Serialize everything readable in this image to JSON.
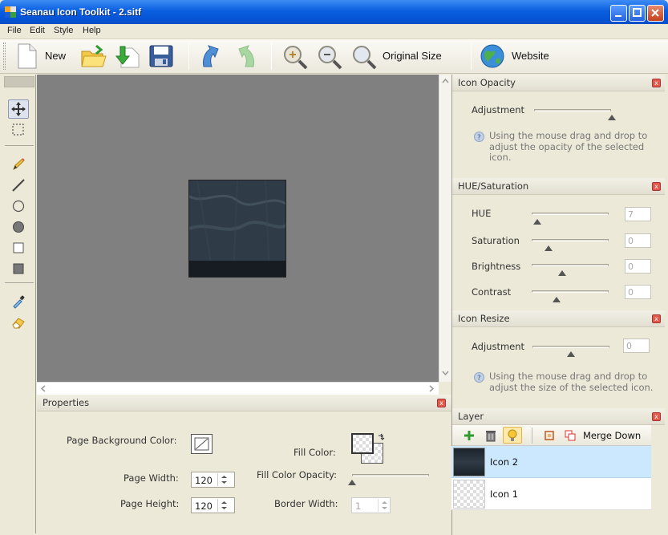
{
  "app": {
    "title": "Seanau Icon Toolkit - 2.sitf"
  },
  "menu": [
    "File",
    "Edit",
    "Style",
    "Help"
  ],
  "toolbar": {
    "new_label": "New",
    "original_size_label": "Original Size",
    "website_label": "Website"
  },
  "icon_opacity": {
    "title": "Icon Opacity",
    "adjustment_label": "Adjustment",
    "hint": "Using the mouse drag and drop to adjust the opacity of the selected icon."
  },
  "hue_saturation": {
    "title": "HUE/Saturation",
    "hue_label": "HUE",
    "hue_value": "7",
    "saturation_label": "Saturation",
    "saturation_value": "0",
    "brightness_label": "Brightness",
    "brightness_value": "0",
    "contrast_label": "Contrast",
    "contrast_value": "0"
  },
  "icon_resize": {
    "title": "Icon Resize",
    "adjustment_label": "Adjustment",
    "adjustment_value": "0",
    "hint": "Using the mouse drag and drop to adjust the size of the selected icon."
  },
  "layer": {
    "title": "Layer",
    "merge_down_label": "Merge Down",
    "items": [
      {
        "name": "Icon 2",
        "selected": true
      },
      {
        "name": "Icon 1",
        "selected": false
      }
    ]
  },
  "properties": {
    "title": "Properties",
    "page_background_color_label": "Page Background Color:",
    "page_width_label": "Page Width:",
    "page_width_value": "120",
    "page_height_label": "Page Height:",
    "page_height_value": "120",
    "fill_color_label": "Fill Color:",
    "fill_color_opacity_label": "Fill Color Opacity:",
    "border_width_label": "Border Width:",
    "border_width_value": "1"
  },
  "colors": {
    "titlebar": "#0a5fe0",
    "selected_row": "#cce8ff",
    "canvas": "#808080"
  }
}
